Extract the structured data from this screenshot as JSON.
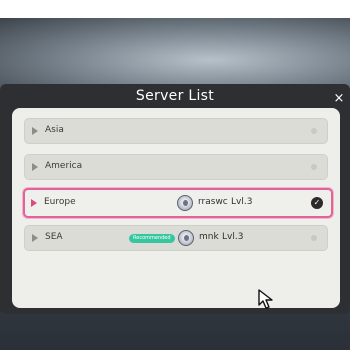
{
  "dialog": {
    "title": "Server List",
    "close_label": "×"
  },
  "servers": [
    {
      "region": "Asia",
      "selected": false
    },
    {
      "region": "America",
      "selected": false
    },
    {
      "region": "Europe",
      "selected": true,
      "player_name": "rraswc",
      "player_level": "Lvl.3"
    },
    {
      "region": "SEA",
      "selected": false,
      "badge": "Recommended",
      "player_name": "mnk",
      "player_level": "Lvl.3"
    }
  ],
  "colors": {
    "selected_border": "#e0649a",
    "badge": "#37c7a0",
    "panel": "#eeeeea",
    "dialog": "#2d2f33"
  },
  "icons": {
    "row_marker": "play-icon",
    "selected_mark": "check-icon",
    "close": "close-icon",
    "pointer": "cursor-icon"
  }
}
